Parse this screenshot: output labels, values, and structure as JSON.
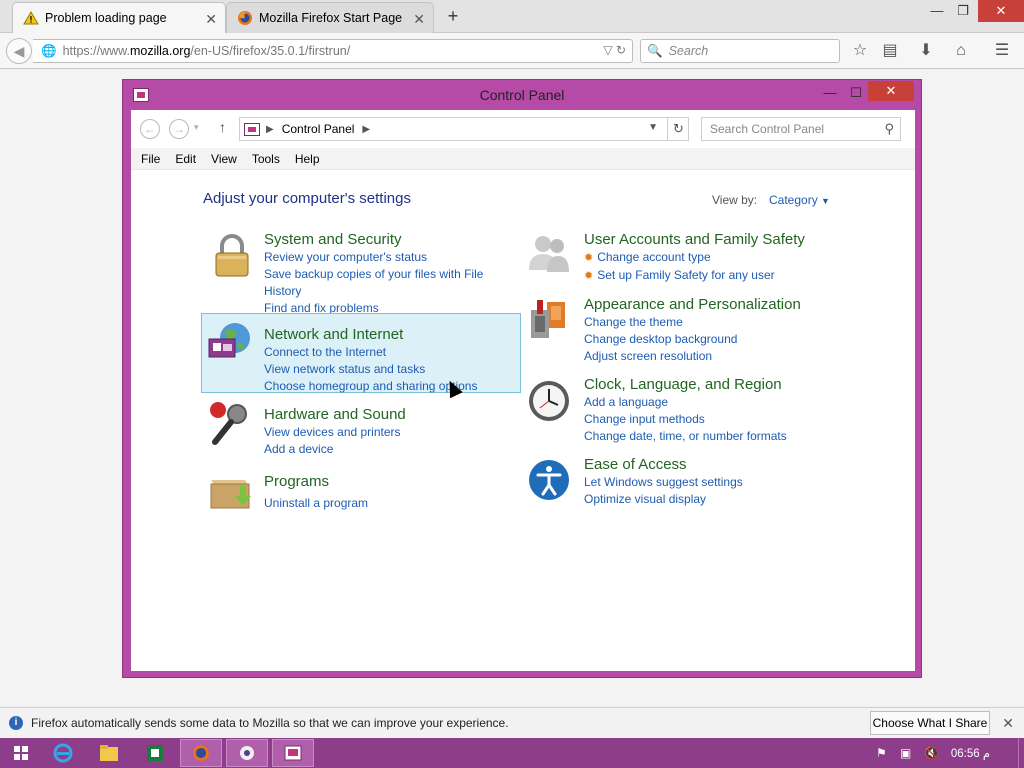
{
  "browser": {
    "tabs": [
      {
        "title": "Problem loading page",
        "icon": "warning-icon",
        "active": true
      },
      {
        "title": "Mozilla Firefox Start Page",
        "icon": "firefox-icon",
        "active": false
      }
    ],
    "url": {
      "scheme": "https://www.",
      "host": "mozilla.org",
      "path": "/en-US/firefox/35.0.1/firstrun/"
    },
    "search_placeholder": "Search"
  },
  "control_panel": {
    "window_title": "Control Panel",
    "breadcrumb": "Control Panel",
    "search_placeholder": "Search Control Panel",
    "menu": [
      "File",
      "Edit",
      "View",
      "Tools",
      "Help"
    ],
    "heading": "Adjust your computer's settings",
    "view_by_label": "View by:",
    "view_by_value": "Category",
    "categories_left": [
      {
        "title": "System and Security",
        "icon": "lock-icon",
        "links": [
          "Review your computer's status",
          "Save backup copies of your files with File",
          "History",
          "Find and fix problems"
        ]
      },
      {
        "title": "Network and Internet",
        "icon": "network-globe-icon",
        "links": [
          "Connect to the Internet",
          "View network status and tasks",
          "Choose homegroup and sharing options"
        ]
      },
      {
        "title": "Hardware and Sound",
        "icon": "microphone-icon",
        "links": [
          "View devices and printers",
          "Add a device"
        ]
      },
      {
        "title": "Programs",
        "icon": "program-box-icon",
        "links": [
          "Uninstall a program"
        ]
      }
    ],
    "categories_right": [
      {
        "title": "User Accounts and Family Safety",
        "icon": "users-icon",
        "links": [
          "Change account type",
          "Set up Family Safety for any user"
        ]
      },
      {
        "title": "Appearance and Personalization",
        "icon": "personalization-icon",
        "links": [
          "Change the theme",
          "Change desktop background",
          "Adjust screen resolution"
        ]
      },
      {
        "title": "Clock, Language, and Region",
        "icon": "clock-icon",
        "links": [
          "Add a language",
          "Change input methods",
          "Change date, time, or number formats"
        ]
      },
      {
        "title": "Ease of Access",
        "icon": "accessibility-icon",
        "links": [
          "Let Windows suggest settings",
          "Optimize visual display"
        ]
      }
    ]
  },
  "notification": {
    "message": "Firefox automatically sends some data to Mozilla so that we can improve your experience.",
    "button": "Choose What I Share"
  },
  "taskbar": {
    "clock": "06:56 م"
  }
}
